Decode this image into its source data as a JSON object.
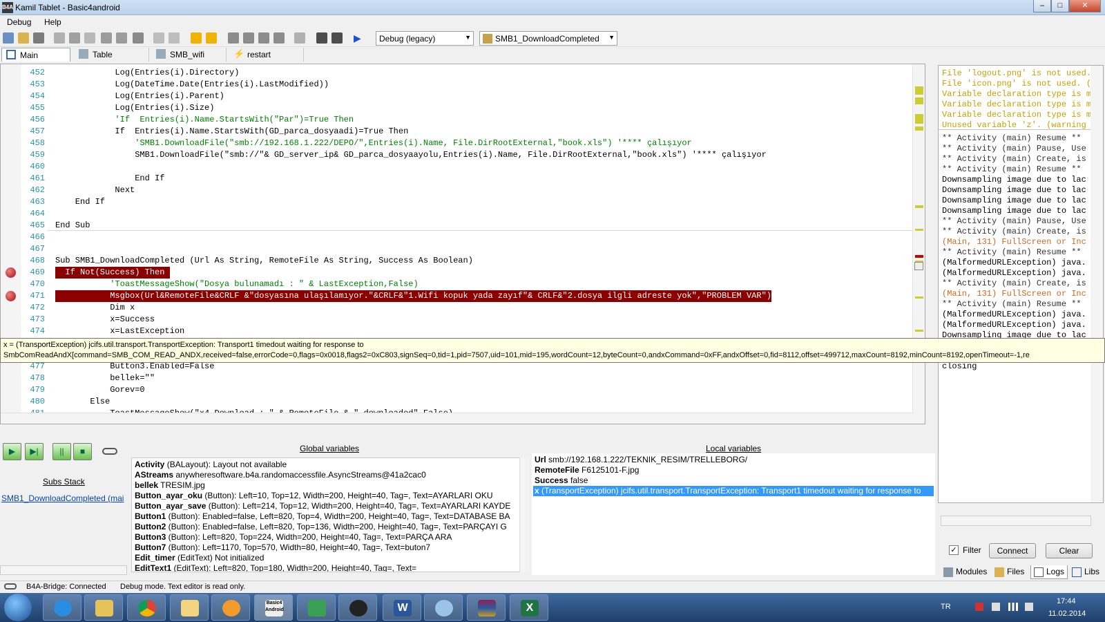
{
  "window": {
    "title": "Kamil Tablet - Basic4android",
    "app_icon": "B4A"
  },
  "menu": [
    "Debug",
    "Help"
  ],
  "toolbar": {
    "mode_combo": "Debug (legacy)",
    "sub_combo": "SMB1_DownloadCompleted"
  },
  "tabs": [
    {
      "label": "Main"
    },
    {
      "label": "Table"
    },
    {
      "label": "SMB_wifi"
    },
    {
      "label": "restart"
    }
  ],
  "code": [
    {
      "n": "452",
      "t": "            Log(Entries(i).Directory)"
    },
    {
      "n": "453",
      "t": "            Log(DateTime.Date(Entries(i).LastModified))"
    },
    {
      "n": "454",
      "t": "            Log(Entries(i).Parent)"
    },
    {
      "n": "455",
      "t": "            Log(Entries(i).Size)"
    },
    {
      "n": "456",
      "t": "            'If  Entries(i).Name.StartsWith(\"Par\")=True Then"
    },
    {
      "n": "457",
      "t": "            If  Entries(i).Name.StartsWith(GD_parca_dosyaadi)=True Then"
    },
    {
      "n": "458",
      "t": "                'SMB1.DownloadFile(\"smb://192.168.1.222/DEPO/\",Entries(i).Name, File.DirRootExternal,\"book.xls\") '**** çalışıyor"
    },
    {
      "n": "459",
      "t": "                SMB1.DownloadFile(\"smb://\"& GD_server_ip& GD_parca_dosyaayolu,Entries(i).Name, File.DirRootExternal,\"book.xls\") '**** çalışıyor"
    },
    {
      "n": "460",
      "t": ""
    },
    {
      "n": "461",
      "t": "                End If"
    },
    {
      "n": "462",
      "t": "            Next"
    },
    {
      "n": "463",
      "t": "    End If"
    },
    {
      "n": "464",
      "t": ""
    },
    {
      "n": "465",
      "t": "End Sub"
    },
    {
      "n": "466",
      "t": ""
    },
    {
      "n": "467",
      "t": ""
    },
    {
      "n": "468",
      "t": "Sub SMB1_DownloadCompleted (Url As String, RemoteFile As String, Success As Boolean)"
    },
    {
      "n": "469",
      "t": "  If Not(Success) Then "
    },
    {
      "n": "470",
      "t": "           'ToastMessageShow(\"Dosya bulunamadı : \" & LastException,False)"
    },
    {
      "n": "471",
      "t": "           Msgbox(Url&RemoteFile&CRLF &\"dosyasına ulaşılamıyor.\"&CRLF&\"1.Wifi kopuk yada zayıf\"& CRLF&\"2.dosya ilgli adreste yok\",\"PROBLEM VAR\")"
    },
    {
      "n": "472",
      "t": "           Dim x"
    },
    {
      "n": "473",
      "t": "           x=Success"
    },
    {
      "n": "474",
      "t": "           x=LastException"
    },
    {
      "n": "477",
      "t": "           Button3.Enabled=False"
    },
    {
      "n": "478",
      "t": "           bellek=\"\""
    },
    {
      "n": "479",
      "t": "           Gorev=0"
    },
    {
      "n": "480",
      "t": "       Else"
    },
    {
      "n": "481",
      "t": "           ToastMessageShow(\"x4 Download : \" & RemoteFile & \" downloaded\",False)"
    },
    {
      "n": "482",
      "t": "           dosya_ac(Gorev,bellek)"
    }
  ],
  "tooltip": {
    "line1": "x = (TransportException) jcifs.util.transport.TransportException: Transport1 timedout waiting for response to",
    "line2": "SmbComReadAndX[command=SMB_COM_READ_ANDX,received=false,errorCode=0,flags=0x0018,flags2=0xC803,signSeq=0,tid=1,pid=7507,uid=101,mid=195,wordCount=12,byteCount=0,andxCommand=0xFF,andxOffset=0,fid=8112,offset=499712,maxCount=8192,minCount=8192,openTimeout=-1,re"
  },
  "logs": {
    "warnings": [
      "File 'logout.png' is not used.",
      "File 'icon.png' is not used. (w",
      "Variable declaration type is mi",
      "Variable declaration type is mi",
      "Variable declaration type is mi",
      "Unused variable 'z'. (warning #"
    ],
    "lines": [
      {
        "t": "** Activity (main) Resume **",
        "c": "#333"
      },
      {
        "t": "** Activity (main) Pause, Use",
        "c": "#333"
      },
      {
        "t": "** Activity (main) Create, is",
        "c": "#333"
      },
      {
        "t": "** Activity (main) Resume **",
        "c": "#333"
      },
      {
        "t": "Downsampling image due to lac",
        "c": "#000"
      },
      {
        "t": "Downsampling image due to lac",
        "c": "#000"
      },
      {
        "t": "Downsampling image due to lac",
        "c": "#000"
      },
      {
        "t": "Downsampling image due to lac",
        "c": "#000"
      },
      {
        "t": "** Activity (main) Pause, Use",
        "c": "#333"
      },
      {
        "t": "** Activity (main) Create, is",
        "c": "#333"
      },
      {
        "t": "(Main, 131) FullScreen or Inc",
        "c": "#d2691e"
      },
      {
        "t": "** Activity (main) Resume **",
        "c": "#333"
      },
      {
        "t": "(MalformedURLException) java.",
        "c": "#000"
      },
      {
        "t": "(MalformedURLException) java.",
        "c": "#000"
      },
      {
        "t": "** Activity (main) Create, is",
        "c": "#333"
      },
      {
        "t": "(Main, 131) FullScreen or Inc",
        "c": "#d2691e"
      },
      {
        "t": "** Activity (main) Resume **",
        "c": "#333"
      },
      {
        "t": "(MalformedURLException) java.",
        "c": "#000"
      },
      {
        "t": "(MalformedURLException) java.",
        "c": "#000"
      },
      {
        "t": "Downsampling image due to lac",
        "c": "#000"
      },
      {
        "t": "** Activity (main) Pause, Use",
        "c": "#333"
      },
      {
        "t": "** Activity (main) Pause, Use",
        "c": "#333"
      },
      {
        "t": "closing",
        "c": "#000"
      }
    ],
    "filter_label": "Filter",
    "filter_checked": true,
    "connect_label": "Connect",
    "clear_label": "Clear"
  },
  "bottom_tabs": [
    "Modules",
    "Files",
    "Logs",
    "Libs"
  ],
  "debug": {
    "subs_stack_title": "Subs Stack",
    "subs_stack_item": "SMB1_DownloadCompleted (mai",
    "globals_title": "Global variables",
    "globals": [
      {
        "name": "Activity",
        "value": "(BALayout): Layout not available"
      },
      {
        "name": "AStreams",
        "value": "anywheresoftware.b4a.randomaccessfile.AsyncStreams@41a2cac0"
      },
      {
        "name": "bellek",
        "value": "TRESIM.jpg"
      },
      {
        "name": "Button_ayar_oku",
        "value": "(Button): Left=10, Top=12, Width=200, Height=40, Tag=, Text=AYARLARI OKU"
      },
      {
        "name": "Button_ayar_save",
        "value": "(Button): Left=214, Top=12, Width=200, Height=40, Tag=, Text=AYARLARI KAYDE"
      },
      {
        "name": "Button1",
        "value": "(Button): Enabled=false, Left=820, Top=4, Width=200, Height=40, Tag=, Text=DATABASE BA"
      },
      {
        "name": "Button2",
        "value": "(Button): Enabled=false, Left=820, Top=136, Width=200, Height=40, Tag=, Text=PARÇAYI G"
      },
      {
        "name": "Button3",
        "value": "(Button): Left=820, Top=224, Width=200, Height=40, Tag=, Text=PARÇA ARA"
      },
      {
        "name": "Button7",
        "value": "(Button): Left=1170, Top=570, Width=80, Height=40, Tag=, Text=buton7"
      },
      {
        "name": "Edit_timer",
        "value": "(EditText) Not initialized"
      },
      {
        "name": "EditText1",
        "value": "(EditText): Left=820, Top=180, Width=200, Height=40, Tag=, Text="
      }
    ],
    "locals_title": "Local variables",
    "locals": [
      {
        "name": "Url",
        "value": "smb://192.168.1.222/TEKNIK_RESIM/TRELLEBORG/"
      },
      {
        "name": "RemoteFile",
        "value": "F6125101-F.jpg"
      },
      {
        "name": "Success",
        "value": "false"
      },
      {
        "name": "x",
        "value": "(TransportException) jcifs.util.transport.TransportException: Transport1 timedout waiting for response to"
      }
    ]
  },
  "status": {
    "bridge": "B4A-Bridge: Connected",
    "mode": "Debug mode. Text editor is read only."
  },
  "taskbar": {
    "lang": "TR",
    "time": "17:44",
    "date": "11.02.2014",
    "b4a_label": "Basic4 Android",
    "apps": [
      "start-orb",
      "internet-explorer",
      "file-explorer",
      "chrome",
      "notepad",
      "media-player",
      "basic4android",
      "download-manager",
      "android-tool",
      "word",
      "paint",
      "winrar",
      "excel"
    ]
  },
  "colors": {
    "breakpoint_line": "#8b0000",
    "keyword": "#0000ff",
    "string": "#000000",
    "comment": "#008000",
    "warning_log": "#c8a000",
    "selected_local": "#3399ff"
  }
}
